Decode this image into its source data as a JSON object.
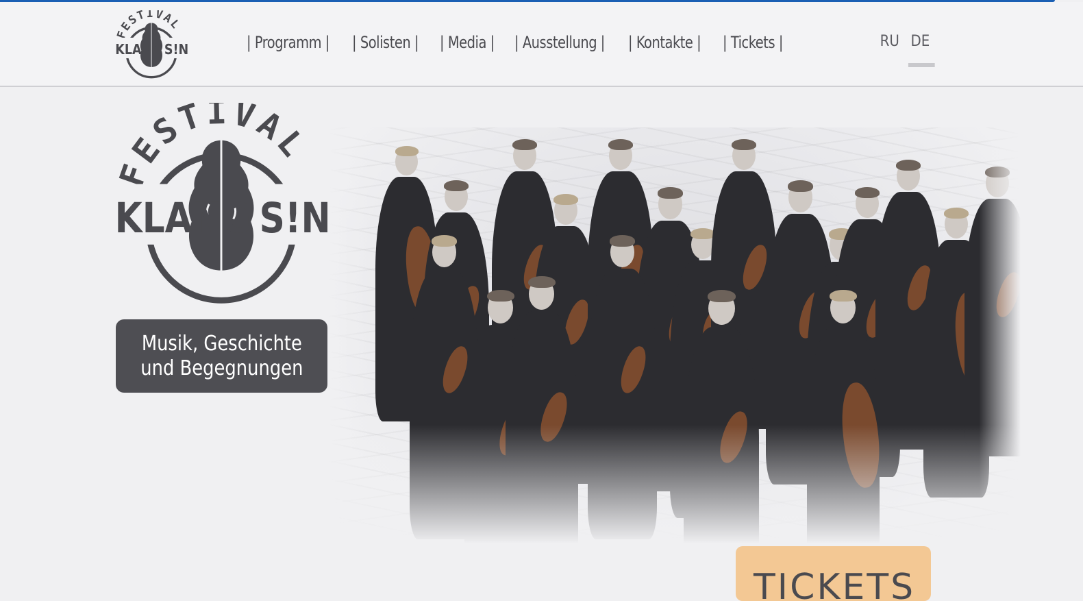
{
  "logo": {
    "arc_text": "FESTIVAL",
    "left_word": "KLANG",
    "right_word": "S!NN"
  },
  "nav": {
    "items": [
      {
        "label": "| Programm |"
      },
      {
        "label": "| Solisten |"
      },
      {
        "label": "| Media |"
      },
      {
        "label": "| Ausstellung |"
      },
      {
        "label": "| Kontakte |"
      },
      {
        "label": "| Tickets |"
      }
    ]
  },
  "languages": {
    "items": [
      {
        "label": "RU"
      },
      {
        "label": "DE"
      }
    ],
    "active": "DE"
  },
  "hero": {
    "tagline": "Musik, Geschichte\nund Begegnungen"
  },
  "tickets": {
    "label": "TICKETS"
  },
  "colors": {
    "accent_bar": "#1a5fb4",
    "tagline_bg": "#4e4e53",
    "tickets_bg": "#f3c894",
    "page_bg": "#f0f0f2"
  }
}
